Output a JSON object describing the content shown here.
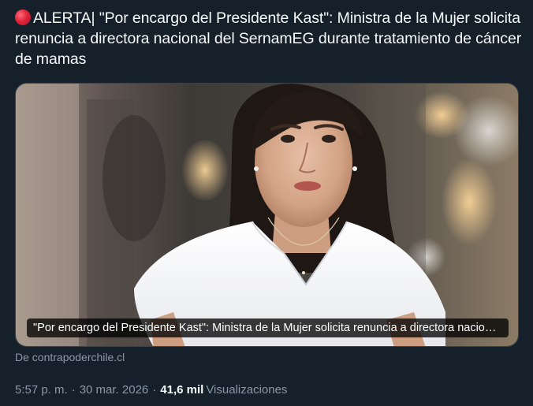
{
  "tweet": {
    "text": "ALERTA| \"Por encargo del Presidente Kast\": Ministra de la Mujer solicita renuncia a directora nacional del SernamEG durante tratamiento de cáncer de mamas",
    "alert_icon": "red-circle-icon",
    "alert_color": "#e0243a"
  },
  "card": {
    "image": "woman-portrait-photo",
    "caption": "\"Por encargo del Presidente Kast\": Ministra de la Mujer solicita renuncia a directora nacional del SernamEG durante tratamiento de cáncer de mamas",
    "source": "De contrapoderchile.cl"
  },
  "meta": {
    "time": "5:57 p. m.",
    "separator": "·",
    "date": "30 mar. 2026",
    "views_count": "41,6 mil",
    "views_label": "Visualizaciones"
  },
  "colors": {
    "background": "#15202b",
    "text": "#f7f9f9",
    "secondary_text": "#8b98a5",
    "border": "#38444d"
  }
}
